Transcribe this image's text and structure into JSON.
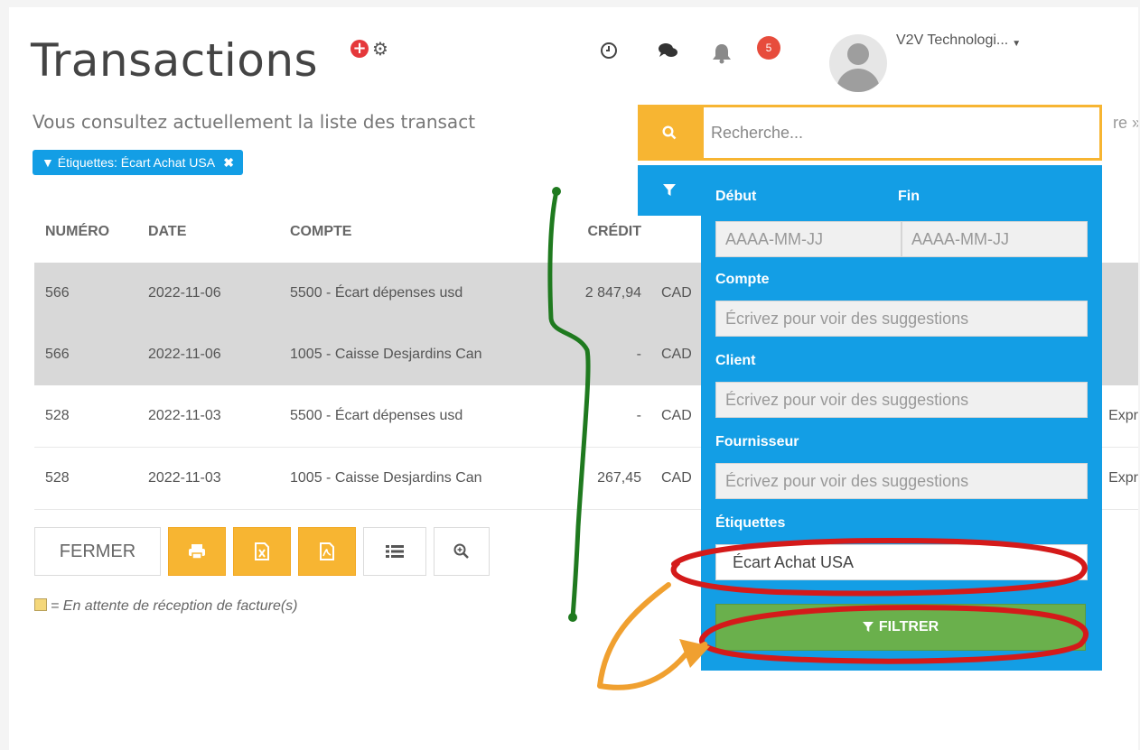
{
  "page": {
    "title": "Transactions",
    "subtitle": "Vous consultez actuellement la liste des transact",
    "subtitle_tail": "re »",
    "active_tag": "Étiquettes: Écart Achat USA",
    "tag_remove": "✖"
  },
  "header": {
    "notification_count": "5",
    "user_name": "V2V Technologi..."
  },
  "table": {
    "columns": [
      "NUMÉRO",
      "DATE",
      "COMPTE",
      "CRÉDIT"
    ],
    "rows": [
      {
        "numero": "566",
        "date": "2022-11-06",
        "compte": "5500 - Écart dépenses usd",
        "credit": "2 847,94",
        "devise": "CAD",
        "extra": ""
      },
      {
        "numero": "566",
        "date": "2022-11-06",
        "compte": "1005 - Caisse Desjardins Can",
        "credit": "-",
        "devise": "CAD",
        "extra": ""
      },
      {
        "numero": "528",
        "date": "2022-11-03",
        "compte": "5500 - Écart dépenses usd",
        "credit": "-",
        "devise": "CAD",
        "extra": "Expr"
      },
      {
        "numero": "528",
        "date": "2022-11-03",
        "compte": "1005 - Caisse Desjardins Can",
        "credit": "267,45",
        "devise": "CAD",
        "extra": "Expr"
      }
    ]
  },
  "toolbar": {
    "close_label": "FERMER"
  },
  "legend": {
    "text": "= En attente de réception de facture(s)"
  },
  "search": {
    "placeholder": "Recherche..."
  },
  "filter": {
    "start_label": "Début",
    "end_label": "Fin",
    "start_placeholder": "AAAA-MM-JJ",
    "end_placeholder": "AAAA-MM-JJ",
    "account_label": "Compte",
    "account_placeholder": "Écrivez pour voir des suggestions",
    "client_label": "Client",
    "client_placeholder": "Écrivez pour voir des suggestions",
    "supplier_label": "Fournisseur",
    "supplier_placeholder": "Écrivez pour voir des suggestions",
    "tags_label": "Étiquettes",
    "tags_value": "Écart Achat USA",
    "submit_label": "FILTRER"
  },
  "colors": {
    "accent_blue": "#139ee5",
    "accent_orange": "#f7b532",
    "filter_green": "#6ab04c",
    "badge_red": "#e74c3c",
    "annotation_green": "#1f7a1f",
    "annotation_red": "#d41a1a",
    "annotation_orange": "#f0a030"
  },
  "icons": {
    "add": "plus-circle-icon",
    "settings": "gear-icon",
    "history": "clock-icon",
    "messages": "chat-icon",
    "notifications": "bell-icon",
    "search": "search-icon",
    "filter": "filter-icon",
    "print": "print-icon",
    "excel": "excel-file-icon",
    "pdf": "pdf-file-icon",
    "list": "list-icon",
    "zoom": "zoom-icon"
  }
}
